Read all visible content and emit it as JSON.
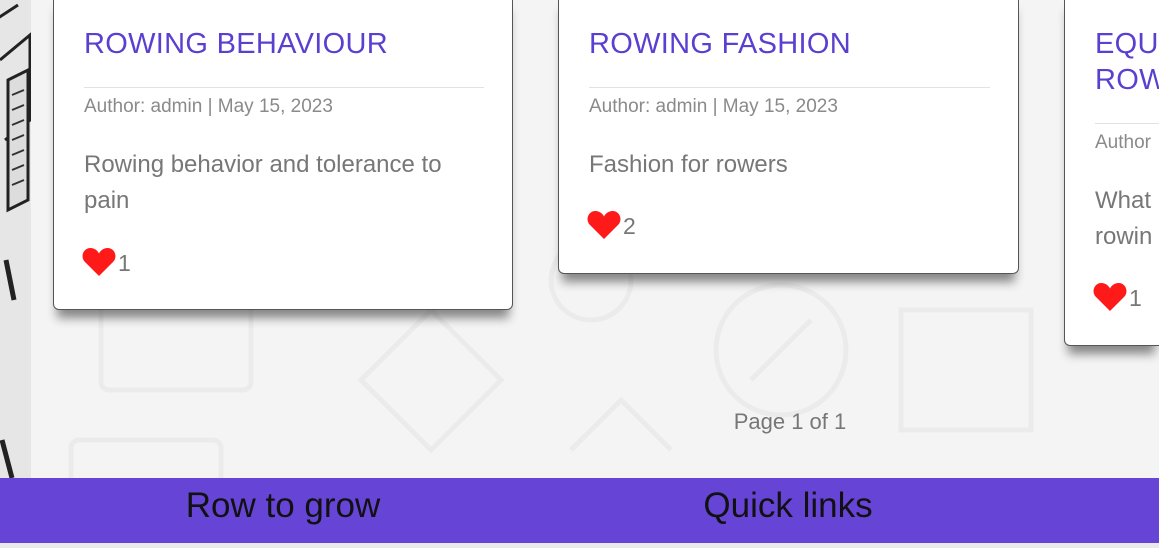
{
  "cards": [
    {
      "title": "ROWING BEHAVIOUR",
      "meta": "Author: admin | May 15, 2023",
      "description": "Rowing behavior and tolerance to pain",
      "likes": "1"
    },
    {
      "title": "ROWING FASHION",
      "meta": "Author: admin | May 15, 2023",
      "description": "Fashion for rowers",
      "likes": "2"
    },
    {
      "title": "EQU\nROW",
      "meta": "Author",
      "description": "What\nrowin",
      "likes": "1"
    }
  ],
  "pagination": {
    "label": "Page 1 of 1"
  },
  "footer": {
    "col1_title": "Row to grow",
    "col2_title": "Quick links"
  },
  "colors": {
    "accent": "#5a3fd0",
    "footer_bg": "#6644d6",
    "heart": "#ff1a1a"
  },
  "icons": {
    "like": "heart-icon"
  }
}
